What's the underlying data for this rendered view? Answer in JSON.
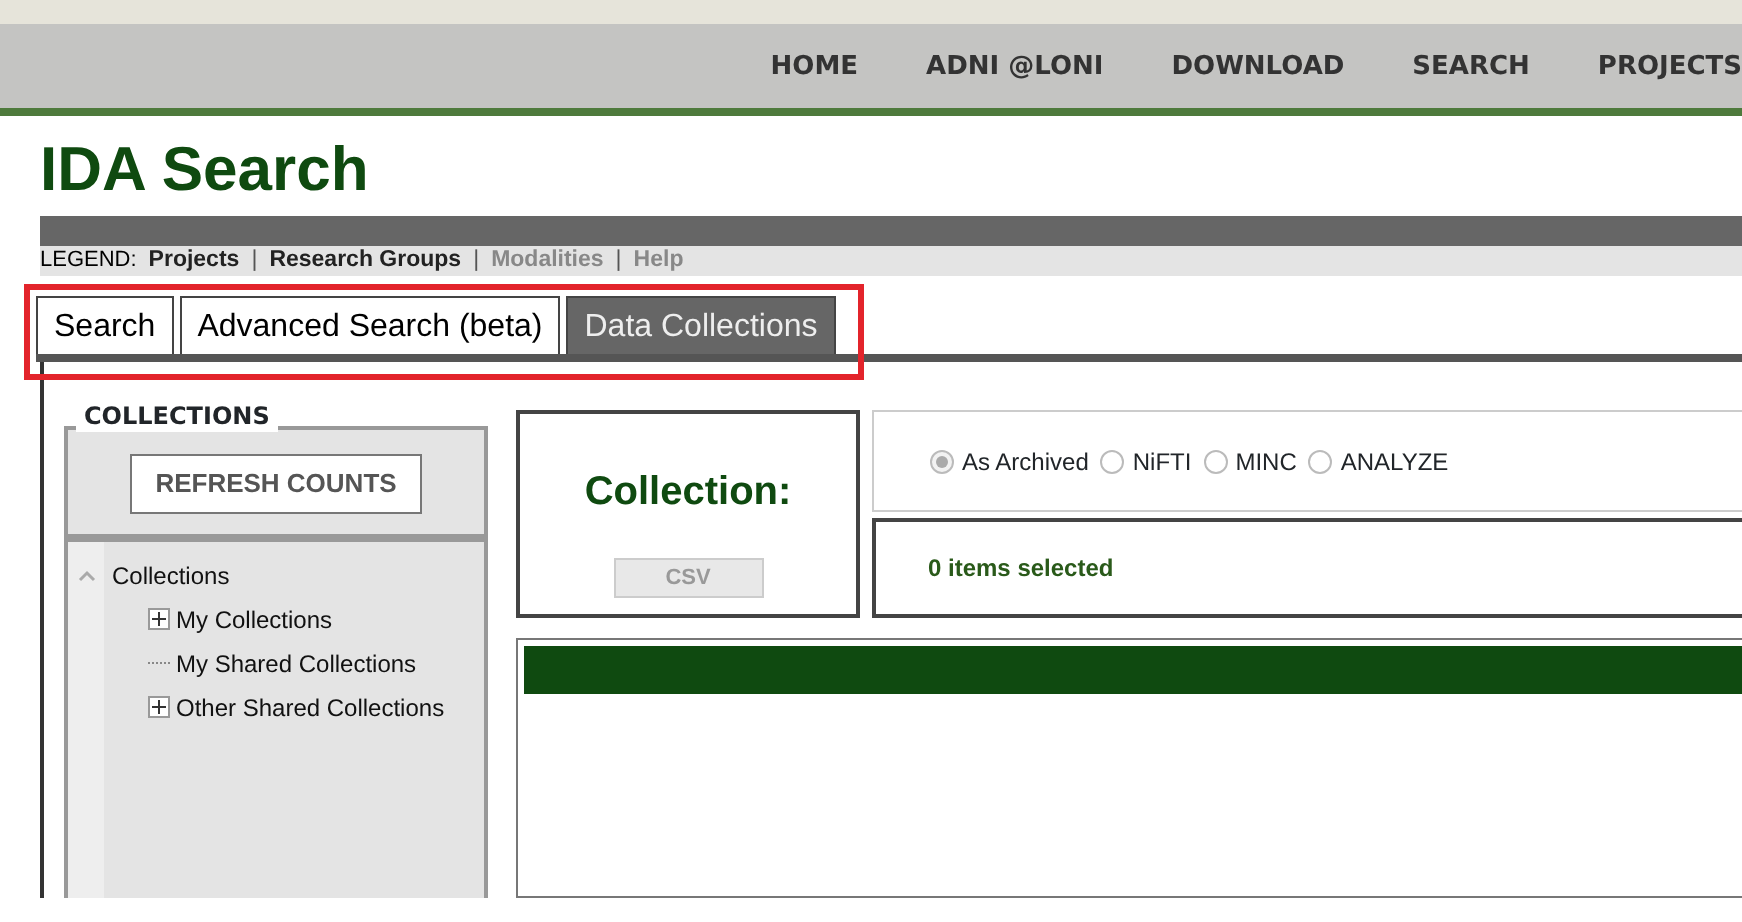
{
  "nav": [
    {
      "label": "HOME"
    },
    {
      "label": "ADNI @LONI"
    },
    {
      "label": "DOWNLOAD"
    },
    {
      "label": "SEARCH"
    },
    {
      "label": "PROJECTS"
    }
  ],
  "page_title": "IDA Search",
  "legend": {
    "label": "LEGEND:",
    "items": [
      {
        "label": "Projects",
        "disabled": false
      },
      {
        "label": "Research Groups",
        "disabled": false
      },
      {
        "label": "Modalities",
        "disabled": true
      },
      {
        "label": "Help",
        "disabled": true
      }
    ],
    "separator": "|"
  },
  "tabs_highlighted": true,
  "tabs": [
    {
      "label": "Search",
      "selected": false
    },
    {
      "label": "Advanced Search (beta)",
      "selected": false
    },
    {
      "label": "Data Collections",
      "selected": true
    }
  ],
  "collections_panel": {
    "title": "COLLECTIONS",
    "refresh_button": "REFRESH COUNTS",
    "tree": [
      {
        "label": "Collections",
        "expanded": true,
        "children": [
          {
            "label": "My Collections",
            "expanded": false
          },
          {
            "label": "My Shared Collections"
          },
          {
            "label": "Other Shared Collections",
            "expanded": false
          }
        ]
      }
    ]
  },
  "collection_box": {
    "label": "Collection:",
    "csv_button": {
      "label": "CSV",
      "disabled": true
    }
  },
  "formats": [
    {
      "label": "As Archived",
      "selected": true,
      "disabled": true
    },
    {
      "label": "NiFTI",
      "selected": false,
      "disabled": false
    },
    {
      "label": "MINC",
      "selected": false,
      "disabled": false
    },
    {
      "label": "ANALYZE",
      "selected": false,
      "disabled": false
    }
  ],
  "selection_status": "0 items selected"
}
